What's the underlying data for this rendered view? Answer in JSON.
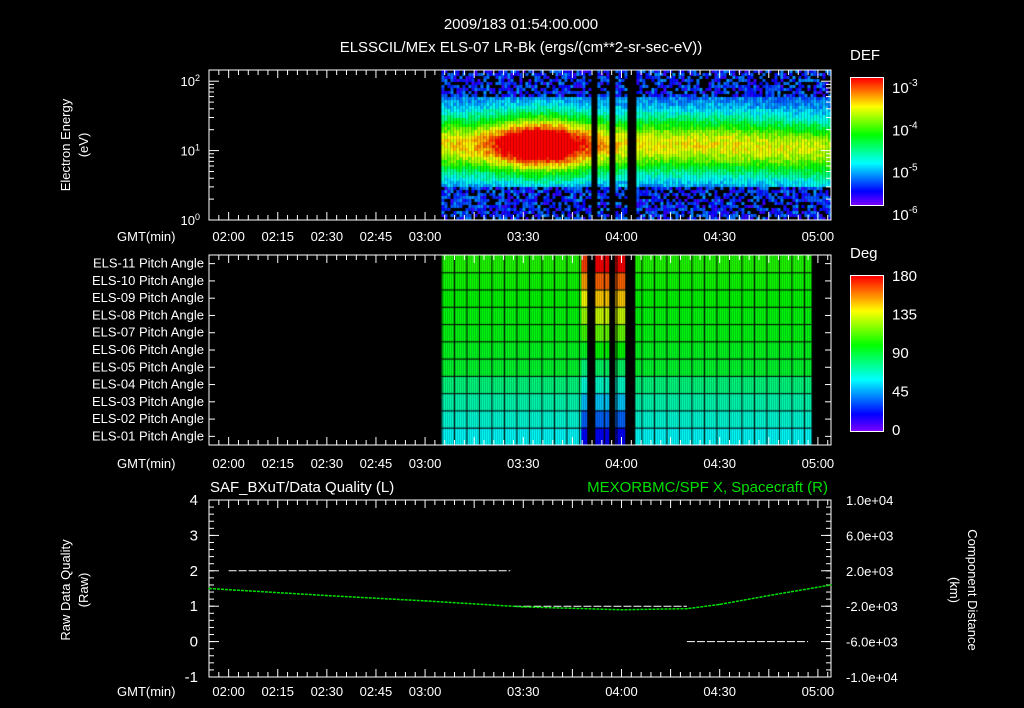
{
  "header": {
    "title": "2009/183 01:54:00.000",
    "subtitle": "ELSSCIL/MEx ELS-07 LR-Bk  (ergs/(cm**2-sr-sec-eV))"
  },
  "time_axis": {
    "label": "GMT(min)",
    "start": "01:54",
    "end": "05:04",
    "ticks_top": [
      "02:00",
      "02:15",
      "02:30",
      "02:45",
      "03:00",
      "03:30",
      "04:00",
      "04:30",
      "05:00"
    ],
    "ticks_bottom": [
      "02:00",
      "02:15",
      "02:30",
      "02:45",
      "03:00",
      "03:30",
      "04:00",
      "04:30",
      "05:00"
    ]
  },
  "chart_data": [
    {
      "type": "heatmap",
      "name": "energy-spectrogram",
      "ylabel": "Electron Energy",
      "yunit": "(eV)",
      "yscale": "log",
      "ylim": [
        1,
        145
      ],
      "yticks": [
        {
          "base": "10",
          "exp": "0",
          "value": 1
        },
        {
          "base": "10",
          "exp": "1",
          "value": 10
        },
        {
          "base": "10",
          "exp": "2",
          "value": 100
        }
      ],
      "colorbar": {
        "label": "DEF",
        "range": [
          1e-06,
          0.001
        ],
        "ticks": [
          {
            "base": "10",
            "exp": "-3"
          },
          {
            "base": "10",
            "exp": "-4"
          },
          {
            "base": "10",
            "exp": "-5"
          },
          {
            "base": "10",
            "exp": "-6"
          }
        ]
      },
      "data_start": "03:05",
      "data_end": "05:04",
      "gaps": [
        [
          "03:50",
          "03:52"
        ],
        [
          "03:56",
          "03:58"
        ],
        [
          "04:01",
          "04:04"
        ]
      ]
    },
    {
      "type": "heatmap",
      "name": "pitch-angle",
      "rows": [
        "ELS-11 Pitch Angle",
        "ELS-10 Pitch Angle",
        "ELS-09 Pitch Angle",
        "ELS-08 Pitch Angle",
        "ELS-07 Pitch Angle",
        "ELS-06 Pitch Angle",
        "ELS-05 Pitch Angle",
        "ELS-04 Pitch Angle",
        "ELS-03 Pitch Angle",
        "ELS-02 Pitch Angle",
        "ELS-01 Pitch Angle"
      ],
      "row_values_deg": [
        105,
        102,
        100,
        98,
        97,
        95,
        93,
        80,
        72,
        66,
        60
      ],
      "colorbar": {
        "label": "Deg",
        "range": [
          0,
          180
        ],
        "ticks": [
          "180",
          "135",
          "90",
          "45",
          "0"
        ]
      },
      "data_start": "03:05",
      "data_end": "04:58"
    },
    {
      "type": "line",
      "name": "data-quality-and-position",
      "title_left": "SAF_BXuT/Data Quality (L)",
      "title_right": "MEXORBMC/SPF X, Spacecraft (R)",
      "ylabel_left": "Raw Data Quality",
      "yunit_left": "(Raw)",
      "ylim_left": [
        -1,
        4
      ],
      "yticks_left": [
        "4",
        "3",
        "2",
        "1",
        "0",
        "-1"
      ],
      "ylabel_right": "Component Distance",
      "yunit_right": "(km)",
      "ylim_right": [
        -10000,
        10000
      ],
      "yticks_right": [
        "1.0e+04",
        "6.0e+03",
        "2.0e+03",
        "-2.0e+03",
        "-6.0e+03",
        "-1.0e+04"
      ],
      "series": [
        {
          "name": "Data Quality",
          "color": "#ffffff",
          "segments": [
            {
              "from": "02:00",
              "to": "03:26",
              "value": 2
            },
            {
              "from": "03:27",
              "to": "04:20",
              "value": 1
            },
            {
              "from": "04:20",
              "to": "04:57",
              "value": 0
            }
          ]
        },
        {
          "name": "SPF X",
          "color": "#00e000",
          "x": [
            "01:54",
            "02:30",
            "03:00",
            "03:30",
            "04:00",
            "04:20",
            "04:30",
            "04:45",
            "05:04"
          ],
          "y": [
            0,
            -800,
            -1400,
            -2080,
            -2400,
            -2280,
            -1800,
            -800,
            400
          ]
        }
      ]
    }
  ]
}
